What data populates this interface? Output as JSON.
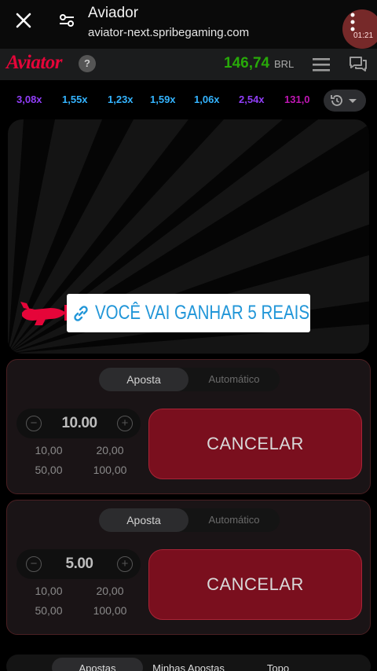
{
  "browser": {
    "title": "Aviador",
    "url": "aviator-next.spribegaming.com",
    "time": "01:21"
  },
  "game": {
    "logo": "Aviator",
    "help": "?",
    "balance": "146,74",
    "currency": "BRL"
  },
  "history": [
    "3,08x",
    "1,55x",
    "1,23x",
    "1,59x",
    "1,06x",
    "2,54x",
    "131,0"
  ],
  "history_colors": [
    "#913ef8",
    "#34b4ff",
    "#34b4ff",
    "#34b4ff",
    "#34b4ff",
    "#913ef8",
    "#c017b4"
  ],
  "sticker": {
    "text": "VOCÊ VAI GANHAR 5 REAIS"
  },
  "panels": [
    {
      "tab_bet": "Aposta",
      "tab_auto": "Automático",
      "amount": "10.00",
      "quick": [
        "10,00",
        "20,00",
        "50,00",
        "100,00"
      ],
      "button": "CANCELAR"
    },
    {
      "tab_bet": "Aposta",
      "tab_auto": "Automático",
      "amount": "5.00",
      "quick": [
        "10,00",
        "20,00",
        "50,00",
        "100,00"
      ],
      "button": "CANCELAR"
    }
  ],
  "bottom_tabs": [
    "Apostas",
    "Minhas Apostas",
    "Topo"
  ],
  "colors": {
    "brand": "#e50539",
    "balance": "#28a909",
    "cancel": "#7a0f1e",
    "sticker_text": "#2196d8"
  }
}
